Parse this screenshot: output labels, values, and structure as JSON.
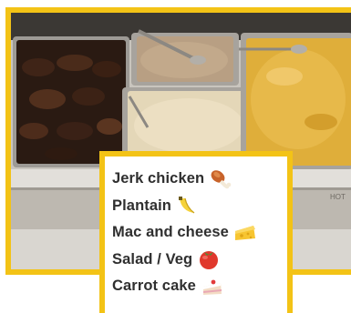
{
  "photo": {
    "description_icon": "food-photo",
    "watermark_text": "HOT"
  },
  "menu": {
    "items": [
      {
        "label": "Jerk chicken",
        "icon": "drumstick-icon"
      },
      {
        "label": "Plantain",
        "icon": "banana-icon"
      },
      {
        "label": "Mac and cheese",
        "icon": "cheese-icon"
      },
      {
        "label": "Salad / Veg",
        "icon": "tomato-icon"
      },
      {
        "label": "Carrot cake",
        "icon": "cake-icon"
      }
    ]
  },
  "colors": {
    "frame": "#f3c316",
    "text": "#2f2f2f",
    "card_bg": "#ffffff"
  }
}
